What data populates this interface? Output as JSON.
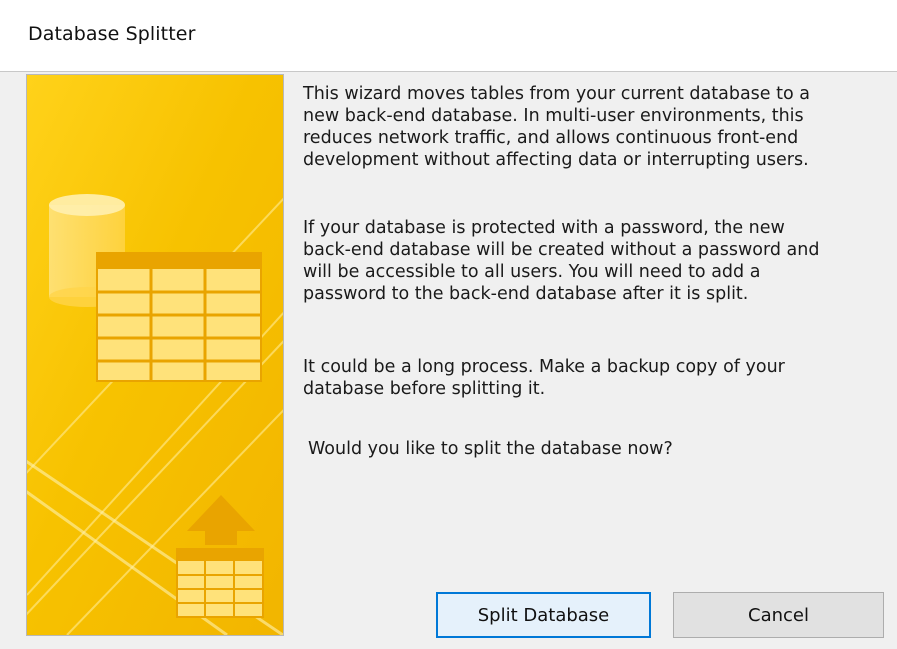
{
  "window": {
    "title": "Database Splitter"
  },
  "content": {
    "paragraph1": "This wizard moves tables from your current database to a\nnew back-end database. In multi-user environments, this\nreduces network traffic, and allows continuous front-end\ndevelopment without affecting data or interrupting users.",
    "paragraph2": "If your database is protected with a password, the new\nback-end database will be created without a password and\nwill be accessible to all users.  You will need to add a\npassword to the back-end database after it is split.",
    "paragraph3": "It could be a long process. Make a backup copy of your\ndatabase before splitting it.",
    "question": "Would you like to split the database now?"
  },
  "buttons": {
    "split_label": "Split Database",
    "cancel_label": "Cancel"
  },
  "banner": {
    "icons": [
      "database-cylinder-icon",
      "table-grid-icon",
      "upload-arrow-icon",
      "small-table-icon"
    ]
  },
  "colors": {
    "banner_yellow": "#f5c000",
    "banner_light": "#ffe27a",
    "focus_border": "#0078d7"
  }
}
